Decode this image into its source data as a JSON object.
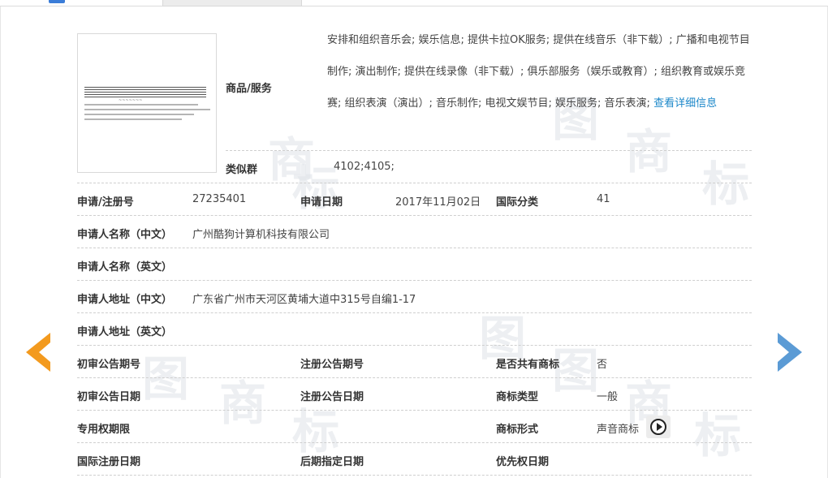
{
  "goods": {
    "label": "商品/服务",
    "text": "安排和组织音乐会; 娱乐信息; 提供卡拉OK服务; 提供在线音乐（非下载）; 广播和电视节目制作; 演出制作; 提供在线录像（非下载）; 俱乐部服务（娱乐或教育）; 组织教育或娱乐竞赛; 组织表演（演出）; 音乐制作; 电视文娱节目; 娱乐服务; 音乐表演; ",
    "link": "查看详细信息"
  },
  "similar_group": {
    "label": "类似群",
    "value": "4102;4105;"
  },
  "reg_no": {
    "label": "申请/注册号",
    "value": "27235401"
  },
  "apply_date": {
    "label": "申请日期",
    "value": "2017年11月02日"
  },
  "intl_class": {
    "label": "国际分类",
    "value": "41"
  },
  "applicant_cn": {
    "label": "申请人名称（中文）",
    "value": "广州酷狗计算机科技有限公司"
  },
  "applicant_en": {
    "label": "申请人名称（英文）",
    "value": ""
  },
  "address_cn": {
    "label": "申请人地址（中文）",
    "value": "广东省广州市天河区黄埔大道中315号自编1-17"
  },
  "address_en": {
    "label": "申请人地址（英文）",
    "value": ""
  },
  "prelim_issue": {
    "label": "初审公告期号",
    "value": ""
  },
  "reg_issue": {
    "label": "注册公告期号",
    "value": ""
  },
  "shared": {
    "label": "是否共有商标",
    "value": "否"
  },
  "prelim_date": {
    "label": "初审公告日期",
    "value": ""
  },
  "reg_date": {
    "label": "注册公告日期",
    "value": ""
  },
  "tm_type": {
    "label": "商标类型",
    "value": "一般"
  },
  "exclusive_period": {
    "label": "专用权期限",
    "value": ""
  },
  "tm_form": {
    "label": "商标形式",
    "value": "声音商标"
  },
  "intl_reg_date": {
    "label": "国际注册日期",
    "value": ""
  },
  "later_date": {
    "label": "后期指定日期",
    "value": ""
  },
  "priority_date": {
    "label": "优先权日期",
    "value": ""
  },
  "watermark": {
    "char1": "商",
    "char2": "标",
    "char3": "图"
  },
  "colors": {
    "link": "#1b87c9",
    "arrow_left": "#f39a1e",
    "arrow_right": "#5b9bd5"
  }
}
